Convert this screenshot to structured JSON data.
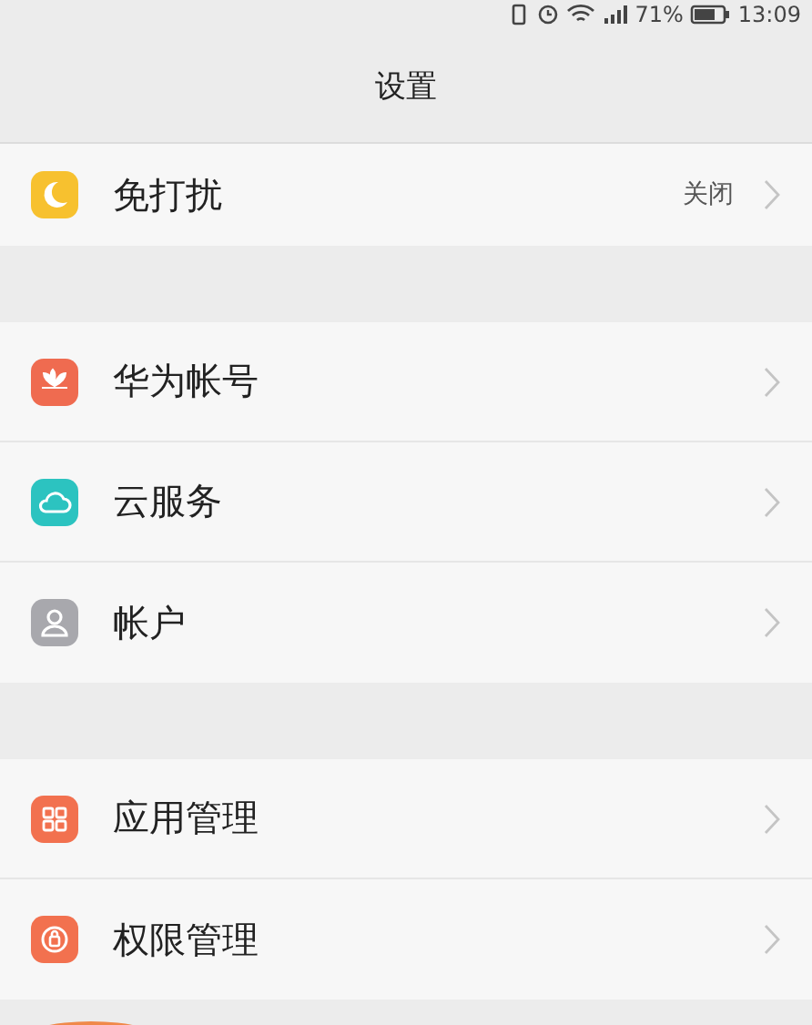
{
  "status_bar": {
    "battery": "71%",
    "time": "13:09"
  },
  "title": "设置",
  "groups": [
    {
      "items": [
        {
          "kind": "moon",
          "color": "#f7c12f",
          "label": "免打扰",
          "value": "关闭"
        }
      ]
    },
    {
      "items": [
        {
          "kind": "flower",
          "color": "#ef6b50",
          "label": "华为帐号"
        },
        {
          "kind": "cloud",
          "color": "#2cc3c0",
          "label": "云服务"
        },
        {
          "kind": "person",
          "color": "#a8a8ad",
          "label": "帐户"
        }
      ]
    },
    {
      "items": [
        {
          "kind": "grid",
          "color": "#f2714f",
          "label": "应用管理"
        },
        {
          "kind": "lock",
          "color": "#f2714f",
          "label": "权限管理"
        }
      ]
    }
  ]
}
